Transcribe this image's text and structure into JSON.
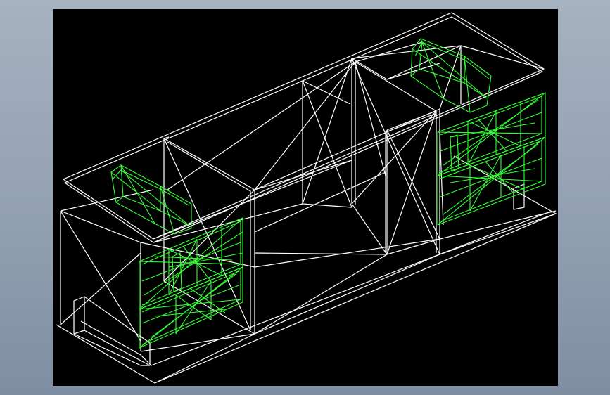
{
  "viewport": {
    "background_color": "#000000",
    "frame_color": "#93a0b1",
    "wireframe_color": "#ffffff",
    "highlight_color": "#33ff33"
  },
  "model": {
    "type": "wireframe-3d-cabinet",
    "drawer_groups": 2,
    "drawers_per_group": 2,
    "top_handles": 2
  }
}
